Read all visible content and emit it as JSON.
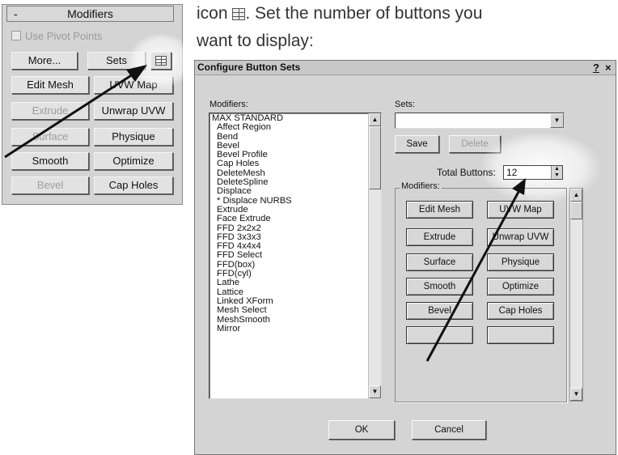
{
  "rollout": {
    "minus": "-",
    "title": "Modifiers",
    "use_pivot": "Use Pivot Points",
    "more": "More...",
    "sets": "Sets",
    "buttons": [
      {
        "label": "Edit Mesh",
        "disabled": false
      },
      {
        "label": "UVW Map",
        "disabled": false
      },
      {
        "label": "Extrude",
        "disabled": true
      },
      {
        "label": "Unwrap UVW",
        "disabled": false
      },
      {
        "label": "Surface",
        "disabled": true
      },
      {
        "label": "Physique",
        "disabled": false
      },
      {
        "label": "Smooth",
        "disabled": false
      },
      {
        "label": "Optimize",
        "disabled": false
      },
      {
        "label": "Bevel",
        "disabled": true
      },
      {
        "label": "Cap Holes",
        "disabled": false
      }
    ]
  },
  "instruction": {
    "part1": "icon",
    "part2": ". Set the number of buttons you",
    "line2": "want to display:"
  },
  "dialog": {
    "title": "Configure Button Sets",
    "help": "?",
    "close": "×",
    "modifiers_label": "Modifiers:",
    "modifier_list": [
      {
        "text": "MAX STANDARD",
        "indent": false
      },
      {
        "text": "Affect Region",
        "indent": true
      },
      {
        "text": "Bend",
        "indent": true
      },
      {
        "text": "Bevel",
        "indent": true
      },
      {
        "text": "Bevel Profile",
        "indent": true
      },
      {
        "text": "Cap Holes",
        "indent": true
      },
      {
        "text": "DeleteMesh",
        "indent": true
      },
      {
        "text": "DeleteSpline",
        "indent": true
      },
      {
        "text": "Displace",
        "indent": true
      },
      {
        "text": "* Displace NURBS",
        "indent": true
      },
      {
        "text": "Extrude",
        "indent": true
      },
      {
        "text": "Face Extrude",
        "indent": true
      },
      {
        "text": "FFD 2x2x2",
        "indent": true
      },
      {
        "text": "FFD 3x3x3",
        "indent": true
      },
      {
        "text": "FFD 4x4x4",
        "indent": true
      },
      {
        "text": "FFD Select",
        "indent": true
      },
      {
        "text": "FFD(box)",
        "indent": true
      },
      {
        "text": "FFD(cyl)",
        "indent": true
      },
      {
        "text": "Lathe",
        "indent": true
      },
      {
        "text": "Lattice",
        "indent": true
      },
      {
        "text": "Linked XForm",
        "indent": true
      },
      {
        "text": "Mesh Select",
        "indent": true
      },
      {
        "text": "MeshSmooth",
        "indent": true
      },
      {
        "text": "Mirror",
        "indent": true
      }
    ],
    "sets_label": "Sets:",
    "sets_value": "",
    "save": "Save",
    "delete": "Delete",
    "total_label": "Total Buttons:",
    "total_value": "12",
    "group_label": "Modifiers:",
    "buttons": [
      {
        "label": "Edit Mesh"
      },
      {
        "label": "UVW Map"
      },
      {
        "label": "Extrude"
      },
      {
        "label": "Unwrap UVW"
      },
      {
        "label": "Surface"
      },
      {
        "label": "Physique"
      },
      {
        "label": "Smooth"
      },
      {
        "label": "Optimize"
      },
      {
        "label": "Bevel"
      },
      {
        "label": "Cap Holes"
      },
      {
        "label": ""
      },
      {
        "label": ""
      }
    ],
    "ok": "OK",
    "cancel": "Cancel"
  }
}
